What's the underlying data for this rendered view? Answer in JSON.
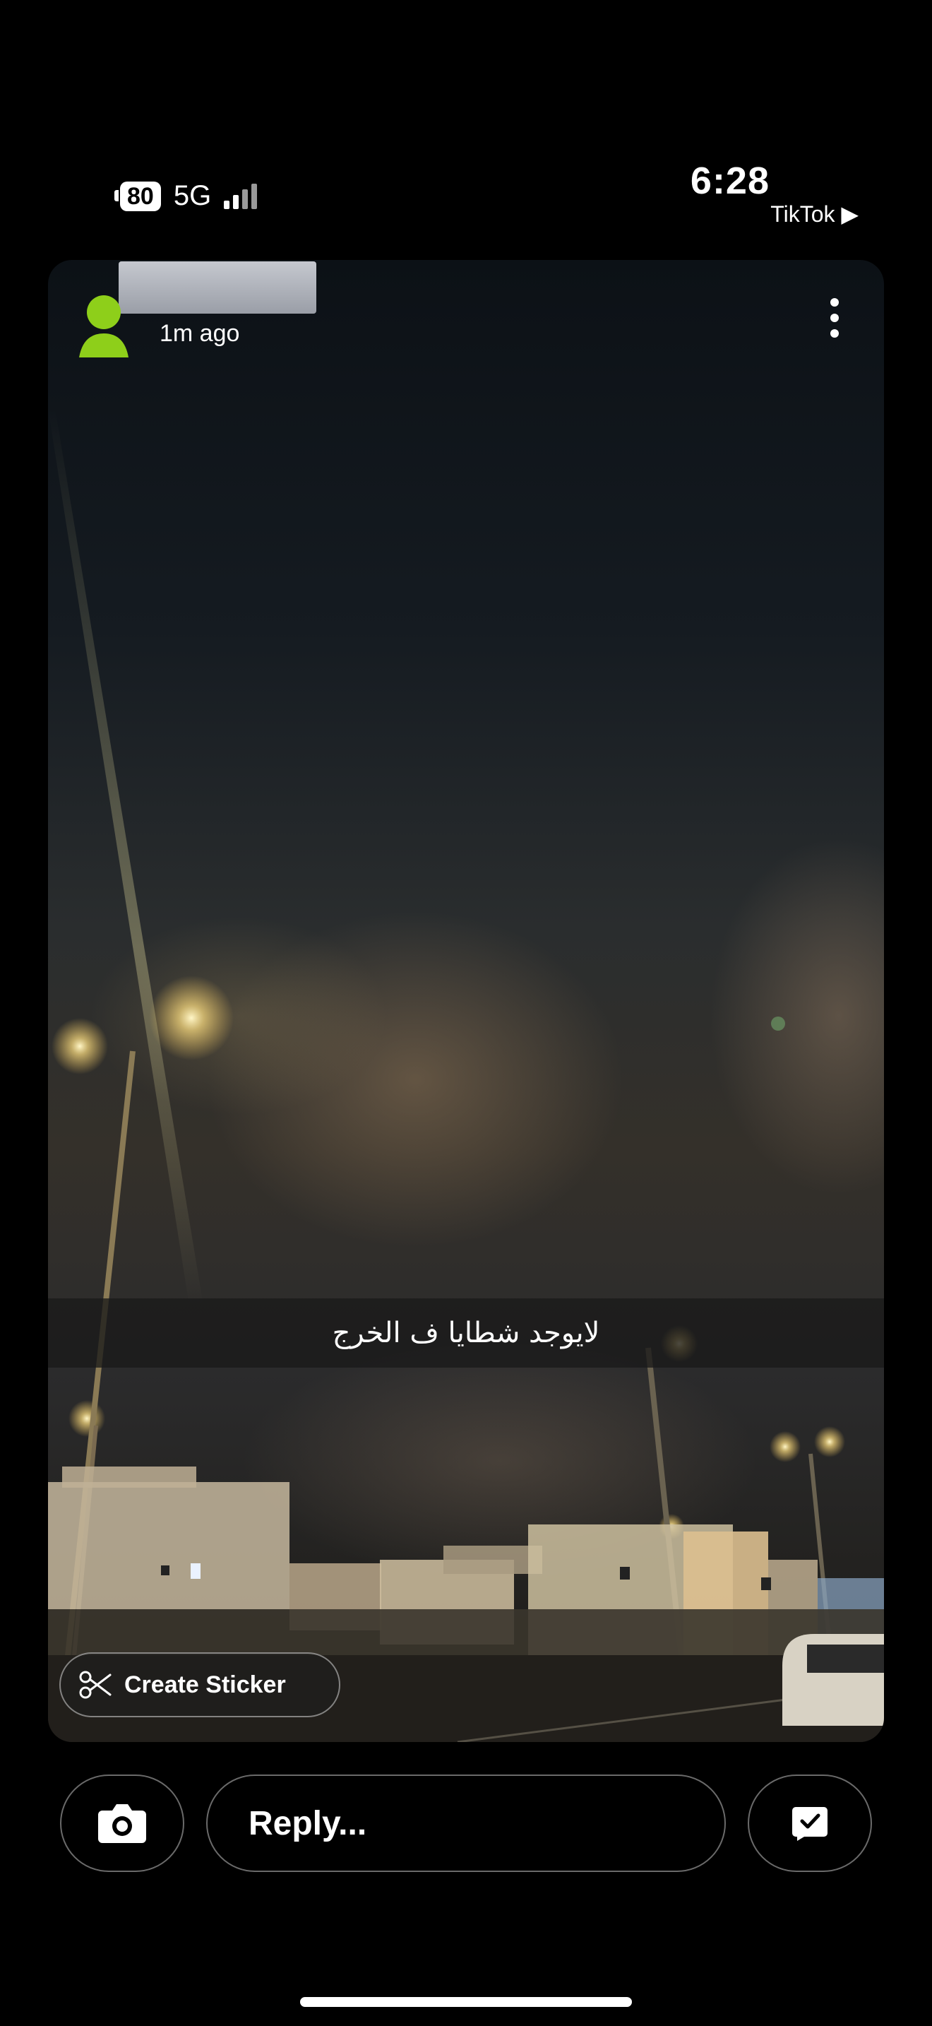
{
  "status_bar": {
    "battery": "80",
    "network": "5G",
    "time": "6:28",
    "back_app": "TikTok ▶"
  },
  "story": {
    "posted": "1m ago",
    "caption": "لايوجد شطايا ف الخرج",
    "create_sticker_label": "Create Sticker"
  },
  "bottom_bar": {
    "reply_placeholder": "Reply..."
  },
  "icons": {
    "avatar": "bitmoji-avatar-icon",
    "more": "more-vertical-icon",
    "scissors": "scissors-icon",
    "camera": "camera-icon",
    "chat": "chat-check-icon"
  },
  "colors": {
    "avatar": "#8ecf1a",
    "background": "#000000"
  }
}
